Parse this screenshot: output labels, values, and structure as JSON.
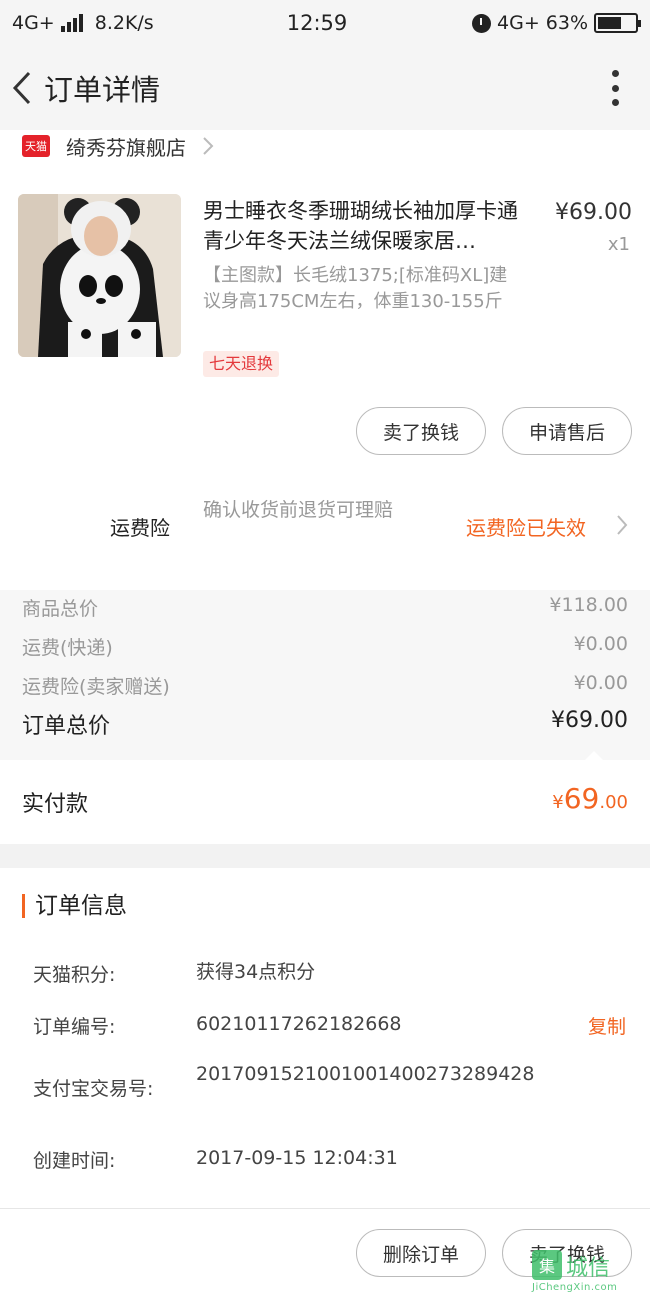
{
  "status_bar": {
    "network": "4G+",
    "speed": "8.2K/s",
    "time": "12:59",
    "network_right": "4G+",
    "battery": "63%",
    "battery_level": 0.63
  },
  "nav": {
    "title": "订单详情"
  },
  "shop": {
    "badge": "天猫",
    "name": "绮秀芬旗舰店"
  },
  "product": {
    "title": "男士睡衣冬季珊瑚绒长袖加厚卡通青少年冬天法兰绒保暖家居…",
    "price": "¥69.00",
    "quantity": "x1",
    "sku": "【主图款】长毛绒1375;[标准码XL]建议身高175CM左右，体重130-155斤",
    "return_policy": "七天退换"
  },
  "item_actions": {
    "sell_label": "卖了换钱",
    "after_sale_label": "申请售后"
  },
  "insurance": {
    "label": "运费险",
    "description": "确认收货前退货可理赔",
    "status": "运费险已失效"
  },
  "summary": {
    "rows": [
      {
        "label": "商品总价",
        "value": "¥118.00"
      },
      {
        "label": "运费(快递)",
        "value": "¥0.00"
      },
      {
        "label": "运费险(卖家赠送)",
        "value": "¥0.00"
      }
    ],
    "total_label": "订单总价",
    "total_value": "¥69.00"
  },
  "paid": {
    "label": "实付款",
    "currency": "¥",
    "integer": "69",
    "decimal": ".00"
  },
  "order_info": {
    "title": "订单信息",
    "points_label": "天猫积分:",
    "points_value": "获得34点积分",
    "order_no_label": "订单编号:",
    "order_no_value": "60210117262182668",
    "copy_label": "复制",
    "alipay_label": "支付宝交易号:",
    "alipay_value": "2017091521001001400273289428",
    "created_label": "创建时间:",
    "created_value": "2017-09-15 12:04:31"
  },
  "bottom_actions": {
    "delete_label": "删除订单",
    "sell_label": "卖了换钱"
  },
  "watermark": {
    "text": "城信",
    "sub": "JiChengXin.com"
  },
  "colors": {
    "accent": "#f26522",
    "tmall_red": "#e4222a",
    "return_badge_bg": "#fdeae6",
    "return_badge_text": "#e4393c",
    "watermark": "#3fbf6a"
  }
}
